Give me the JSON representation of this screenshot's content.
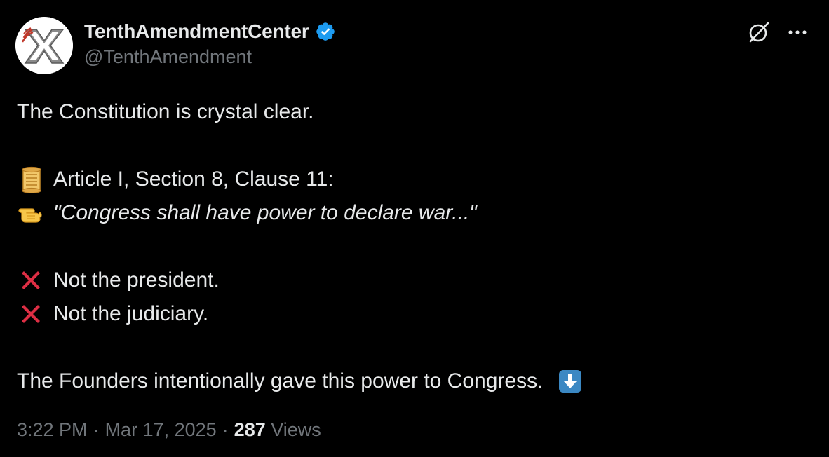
{
  "author": {
    "display_name": "TenthAmendmentCenter",
    "handle": "@TenthAmendment",
    "verified": true,
    "avatar_icon": "tenth-amendment-x-logo",
    "verified_color": "#1d9bf0"
  },
  "header_actions": {
    "grok_icon": "grok-icon",
    "more_icon": "more-icon"
  },
  "tweet": {
    "line1": "The Constitution is crystal clear.",
    "line2_icon": "scroll-emoji",
    "line2": "Article I, Section 8, Clause 11:",
    "line3_icon": "pointing-hand-emoji",
    "line3": "\"Congress shall have power to declare war...\"",
    "line4_icon": "cross-mark-emoji",
    "line4": "Not the president.",
    "line5_icon": "cross-mark-emoji",
    "line5": "Not the judiciary.",
    "line6": "The Founders intentionally gave this power to Congress.",
    "line6_icon": "down-arrow-emoji"
  },
  "meta": {
    "time": "3:22 PM",
    "separator": "·",
    "date": "Mar 17, 2025",
    "views_count": "287",
    "views_label": "Views"
  },
  "colors": {
    "background": "#000000",
    "text": "#e7e9ea",
    "secondary": "#71767b",
    "cross_red": "#dd2e44",
    "down_arrow_blue": "#3b88c3"
  }
}
